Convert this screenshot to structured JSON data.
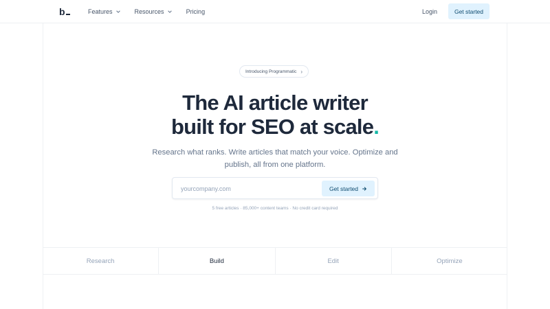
{
  "nav": {
    "logo": "b",
    "links": [
      {
        "label": "Features",
        "dropdown": true
      },
      {
        "label": "Resources",
        "dropdown": true
      },
      {
        "label": "Pricing",
        "dropdown": false
      }
    ],
    "login": "Login",
    "cta": "Get started"
  },
  "hero": {
    "pill": "Introducing Programmatic",
    "headline_line1": "The AI article writer",
    "headline_line2": "built for SEO at scale",
    "headline_dot": ".",
    "subtitle_line1": "Research what ranks. Write articles that match your voice. Optimize and",
    "subtitle_line2": "publish, all from one platform.",
    "input_placeholder": "yourcompany.com",
    "input_button": "Get started",
    "fine_print": "5 free articles · 85,000+ content teams · No credit card required"
  },
  "tabs": [
    "Research",
    "Build",
    "Edit",
    "Optimize"
  ],
  "active_tab": "Build",
  "colors": {
    "accent_dot": "#14b8a6",
    "cta_bg": "#e0f2fe",
    "cta_text": "#0c4a6e",
    "heading": "#1e293b"
  }
}
